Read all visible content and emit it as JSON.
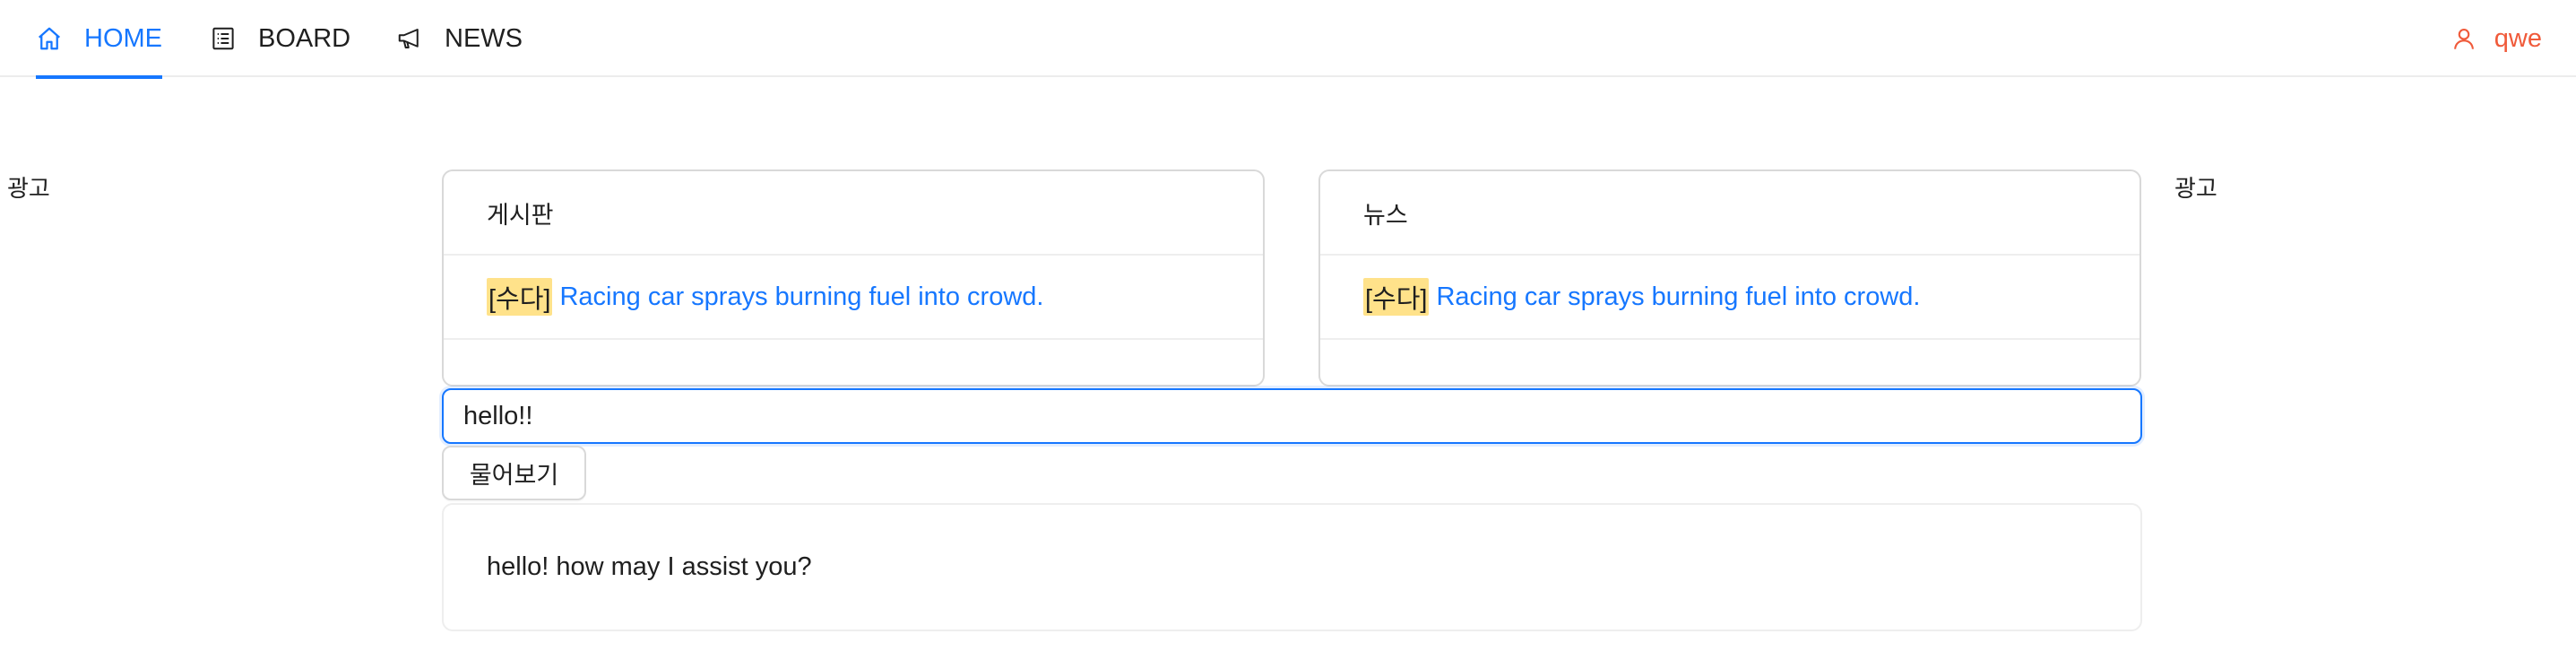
{
  "nav": {
    "items": [
      {
        "label": "HOME",
        "icon": "home-icon",
        "active": true
      },
      {
        "label": "BOARD",
        "icon": "list-icon",
        "active": false
      },
      {
        "label": "NEWS",
        "icon": "megaphone-icon",
        "active": false
      }
    ],
    "user": {
      "name": "qwe",
      "icon": "user-icon"
    }
  },
  "ads": {
    "left": "광고",
    "right": "광고"
  },
  "cards": {
    "board": {
      "title": "게시판",
      "posts": [
        {
          "tag": "[수다]",
          "title": "Racing car sprays burning fuel into crowd."
        }
      ]
    },
    "news": {
      "title": "뉴스",
      "posts": [
        {
          "tag": "[수다]",
          "title": "Racing car sprays burning fuel into crowd."
        }
      ]
    }
  },
  "chat": {
    "input_value": "hello!!",
    "ask_label": "물어보기",
    "answer": "hello! how may I assist you?"
  },
  "colors": {
    "accent": "#1677ff",
    "user": "#f05a3a",
    "tag_bg": "#ffe28a"
  }
}
